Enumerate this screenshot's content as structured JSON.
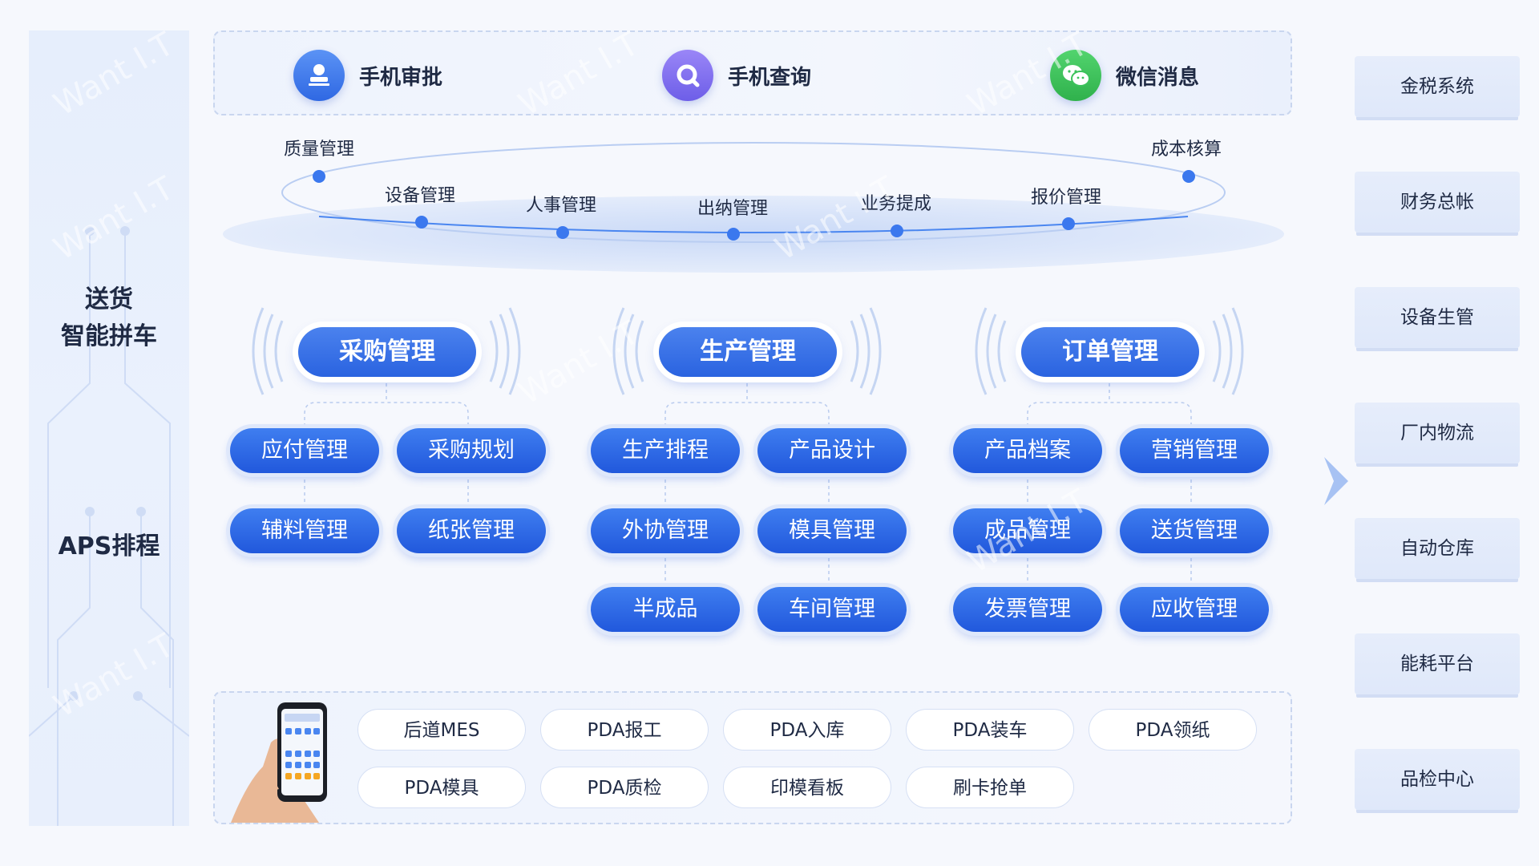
{
  "left": {
    "label_1": "送货",
    "label_2": "智能拼车",
    "label_3": "APS排程"
  },
  "top": {
    "items": [
      {
        "label": "手机审批",
        "icon": "stamp-icon",
        "color": "#3f7ef0"
      },
      {
        "label": "手机查询",
        "icon": "search-icon",
        "color": "#7a6cf0"
      },
      {
        "label": "微信消息",
        "icon": "wechat-icon",
        "color": "#39c159"
      }
    ]
  },
  "orbit": {
    "labels": [
      "质量管理",
      "设备管理",
      "人事管理",
      "出纳管理",
      "业务提成",
      "报价管理",
      "成本核算"
    ]
  },
  "modules": [
    {
      "title": "采购管理",
      "items": [
        "应付管理",
        "采购规划",
        "辅料管理",
        "纸张管理"
      ]
    },
    {
      "title": "生产管理",
      "items": [
        "生产排程",
        "产品设计",
        "外协管理",
        "模具管理",
        "半成品",
        "车间管理"
      ]
    },
    {
      "title": "订单管理",
      "items": [
        "产品档案",
        "营销管理",
        "成品管理",
        "送货管理",
        "发票管理",
        "应收管理"
      ]
    }
  ],
  "bottom": {
    "items": [
      "后道MES",
      "PDA报工",
      "PDA入库",
      "PDA装车",
      "PDA领纸",
      "PDA模具",
      "PDA质检",
      "印模看板",
      "刷卡抢单"
    ]
  },
  "right": {
    "items": [
      "金税系统",
      "财务总帐",
      "设备生管",
      "厂内物流",
      "自动仓库",
      "能耗平台",
      "品检中心"
    ]
  },
  "watermark": "Want I.T",
  "colors": {
    "accent": "#2a63e0",
    "background": "#f6f8fd"
  }
}
